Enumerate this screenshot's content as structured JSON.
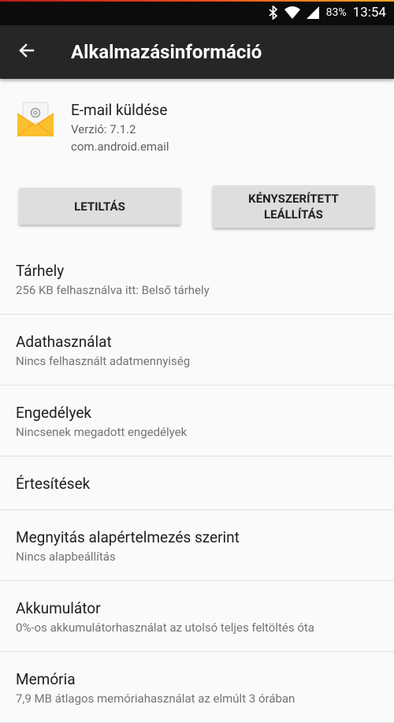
{
  "status_bar": {
    "battery": "83%",
    "time": "13:54"
  },
  "toolbar": {
    "title": "Alkalmazásinformáció"
  },
  "app": {
    "name": "E-mail küldése",
    "version": "Verzió: 7.1.2",
    "package": "com.android.email"
  },
  "buttons": {
    "disable": "LETILTÁS",
    "force_stop": "KÉNYSZERÍTETT\nLEÁLLÍTÁS"
  },
  "items": [
    {
      "title": "Tárhely",
      "subtitle": "256 KB felhasználva itt: Belső tárhely"
    },
    {
      "title": "Adathasználat",
      "subtitle": "Nincs felhasznált adatmennyiség"
    },
    {
      "title": "Engedélyek",
      "subtitle": "Nincsenek megadott engedélyek"
    },
    {
      "title": "Értesítések",
      "subtitle": ""
    },
    {
      "title": "Megnyitás alapértelmezés szerint",
      "subtitle": "Nincs alapbeállítás"
    },
    {
      "title": "Akkumulátor",
      "subtitle": "0%-os akkumulátorhasználat az utolsó teljes feltöltés óta"
    },
    {
      "title": "Memória",
      "subtitle": "7,9 MB átlagos memóriahasználat az elmúlt 3 órában"
    }
  ],
  "colors": {
    "toolbar": "#262626",
    "status_bar": "#0c0c0c",
    "background": "#fafafa",
    "button": "#dedede"
  }
}
